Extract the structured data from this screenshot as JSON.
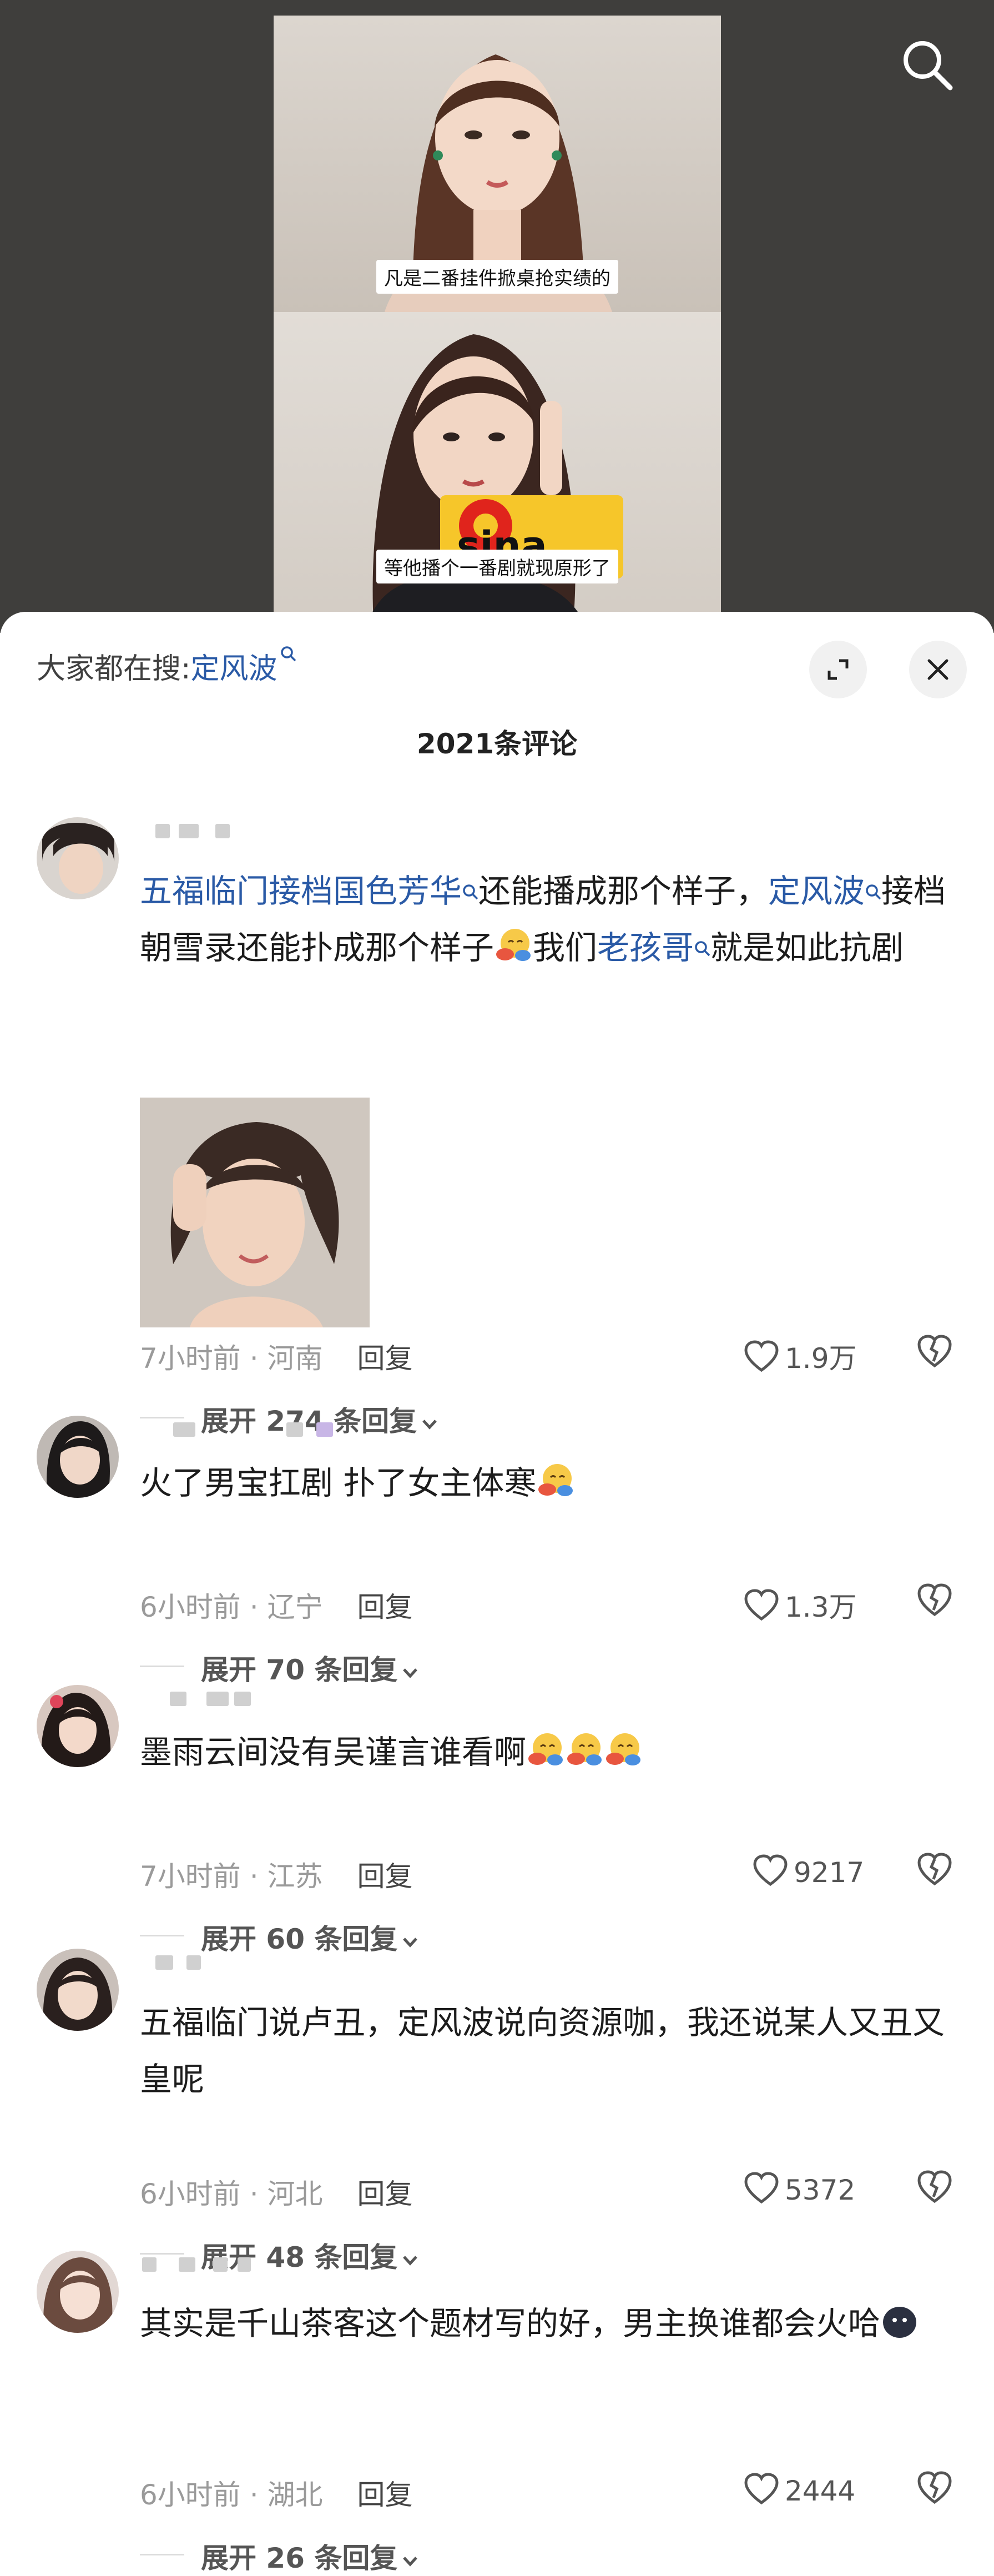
{
  "video": {
    "subtitle_top": "凡是二番挂件掀桌抢实绩的",
    "subtitle_bottom": "等他播个一番剧就现原形了",
    "watermark": "sina",
    "search_icon": "search-icon"
  },
  "header": {
    "search_prefix": "大家都在搜:",
    "search_term": "定风波",
    "comment_count": "2021条评论",
    "expand_icon": "expand-icon",
    "close_icon": "close-icon"
  },
  "comments": [
    {
      "text_parts": [
        "五福临门接档国色芳华",
        "还能播成那个样子，",
        "定风波",
        "接档朝雪录还能扑成那个样子",
        "我们",
        "老孩哥",
        "就是如此抗剧"
      ],
      "time": "7小时前",
      "location": "河南",
      "reply_label": "回复",
      "likes": "1.9万",
      "expand_label": "展开 274 条回复",
      "has_image": true
    },
    {
      "text": "火了男宝扛剧 扑了女主体寒",
      "time": "6小时前",
      "location": "辽宁",
      "reply_label": "回复",
      "likes": "1.3万",
      "expand_label": "展开 70 条回复"
    },
    {
      "text": "墨雨云间没有吴谨言谁看啊",
      "time": "7小时前",
      "location": "江苏",
      "reply_label": "回复",
      "likes": "9217",
      "expand_label": "展开 60 条回复"
    },
    {
      "text": "五福临门说卢丑，定风波说向资源咖，我还说某人又丑又皇呢",
      "time": "6小时前",
      "location": "河北",
      "reply_label": "回复",
      "likes": "5372",
      "expand_label": "展开 48 条回复"
    },
    {
      "text": "其实是千山茶客这个题材写的好，男主换谁都会火哈",
      "time": "6小时前",
      "location": "湖北",
      "reply_label": "回复",
      "likes": "2444",
      "expand_label": "展开 26 条回复"
    }
  ],
  "colors": {
    "link": "#2a5aa6",
    "meta": "#9a9a9a",
    "video_bg": "#3f3e3c"
  }
}
